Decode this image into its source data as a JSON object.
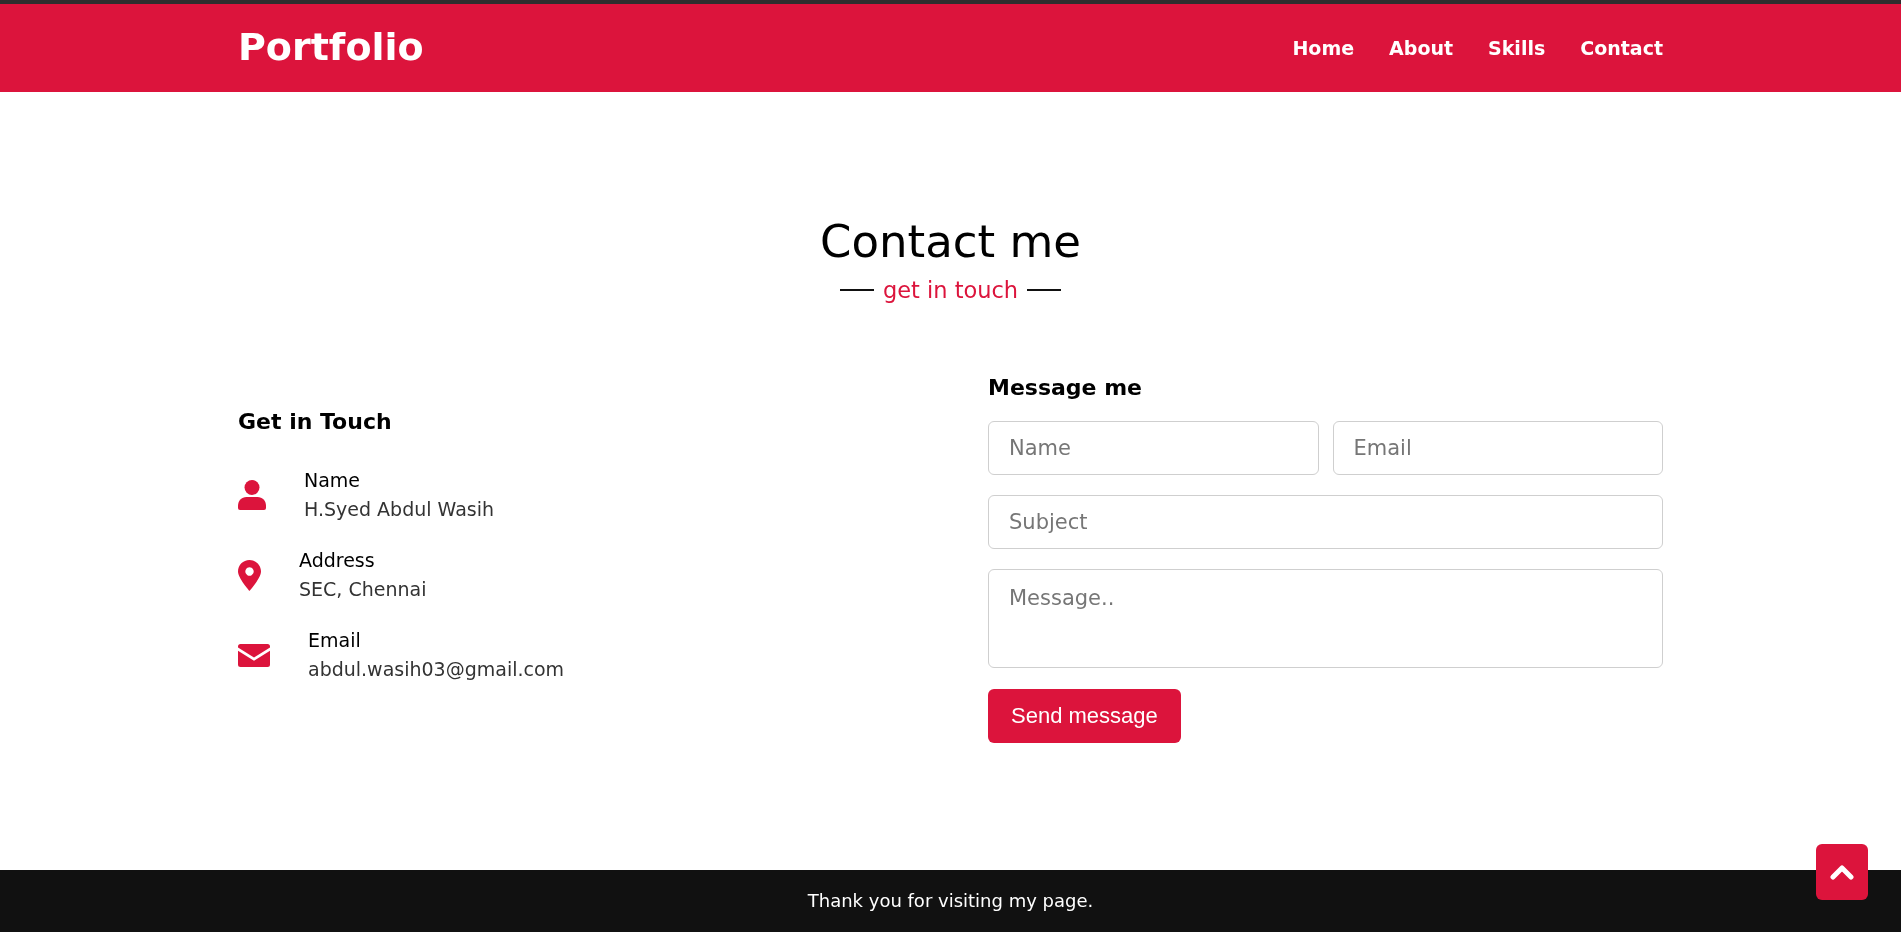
{
  "navbar": {
    "logo": "Portfolio",
    "links": [
      "Home",
      "About",
      "Skills",
      "Contact"
    ]
  },
  "heading": {
    "title": "Contact me",
    "subtitle": "get in touch"
  },
  "contact_info": {
    "heading": "Get in Touch",
    "items": [
      {
        "label": "Name",
        "value": "H.Syed Abdul Wasih"
      },
      {
        "label": "Address",
        "value": "SEC, Chennai"
      },
      {
        "label": "Email",
        "value": "abdul.wasih03@gmail.com"
      }
    ]
  },
  "message_form": {
    "heading": "Message me",
    "rows": [
      [
        {
          "kind": "input",
          "placeholder": "Name"
        },
        {
          "kind": "input",
          "placeholder": "Email"
        }
      ],
      [
        {
          "kind": "input",
          "placeholder": "Subject"
        }
      ],
      [
        {
          "kind": "textarea",
          "placeholder": "Message.."
        }
      ]
    ],
    "button": "Send message"
  },
  "footer": {
    "text": "Thank you for visiting my page."
  }
}
